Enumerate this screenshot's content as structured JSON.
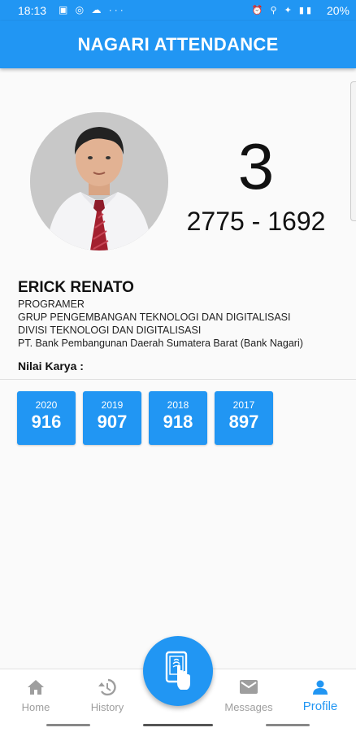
{
  "status": {
    "time": "18:13",
    "battery": "20%"
  },
  "app": {
    "title": "NAGARI ATTENDANCE"
  },
  "profile": {
    "big_number": "3",
    "code": "2775 - 1692",
    "name": "ERICK RENATO",
    "position": "PROGRAMER",
    "group": "GRUP PENGEMBANGAN TEKNOLOGI DAN DIGITALISASI",
    "division": "DIVISI TEKNOLOGI DAN DIGITALISASI",
    "company": "PT. Bank Pembangunan Daerah Sumatera Barat (Bank Nagari)",
    "nilai_label": "Nilai Karya :"
  },
  "scores": [
    {
      "year": "2020",
      "value": "916"
    },
    {
      "year": "2019",
      "value": "907"
    },
    {
      "year": "2018",
      "value": "918"
    },
    {
      "year": "2017",
      "value": "897"
    }
  ],
  "nav": {
    "home": "Home",
    "history": "History",
    "messages": "Messages",
    "profile": "Profile"
  },
  "colors": {
    "primary": "#2196f3",
    "inactive": "#9e9e9e"
  }
}
